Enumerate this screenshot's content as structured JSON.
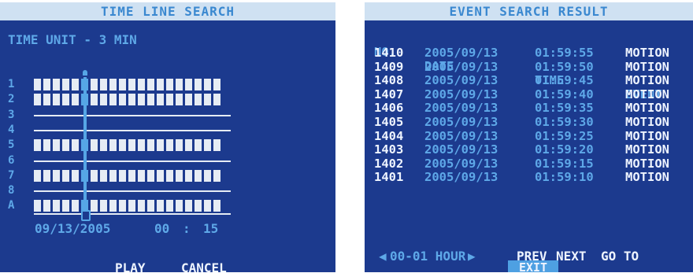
{
  "left_panel": {
    "title": "TIME LINE SEARCH",
    "time_unit": "TIME UNIT - 3 MIN",
    "channels": [
      {
        "label": "1",
        "has_recording": true
      },
      {
        "label": "2",
        "has_recording": true
      },
      {
        "label": "3",
        "has_recording": false
      },
      {
        "label": "4",
        "has_recording": false
      },
      {
        "label": "5",
        "has_recording": true
      },
      {
        "label": "6",
        "has_recording": false
      },
      {
        "label": "7",
        "has_recording": true
      },
      {
        "label": "8",
        "has_recording": false
      },
      {
        "label": "A",
        "has_recording": true
      }
    ],
    "date": "09/13/2005",
    "time_hour": "00",
    "time_sep": ":",
    "time_minute": "15",
    "play_label": "PLAY",
    "cancel_label": "CANCEL"
  },
  "right_panel": {
    "title": "EVENT SEARCH RESULT",
    "headers": {
      "no": "NO.",
      "date": "DATE",
      "time": "TIME",
      "event": "EVENT"
    },
    "rows": [
      {
        "no": "1410",
        "date": "2005/09/13",
        "time": "01:59:55",
        "event": "MOTION"
      },
      {
        "no": "1409",
        "date": "2005/09/13",
        "time": "01:59:50",
        "event": "MOTION"
      },
      {
        "no": "1408",
        "date": "2005/09/13",
        "time": "01:59:45",
        "event": "MOTION"
      },
      {
        "no": "1407",
        "date": "2005/09/13",
        "time": "01:59:40",
        "event": "MOTION"
      },
      {
        "no": "1406",
        "date": "2005/09/13",
        "time": "01:59:35",
        "event": "MOTION"
      },
      {
        "no": "1405",
        "date": "2005/09/13",
        "time": "01:59:30",
        "event": "MOTION"
      },
      {
        "no": "1404",
        "date": "2005/09/13",
        "time": "01:59:25",
        "event": "MOTION"
      },
      {
        "no": "1403",
        "date": "2005/09/13",
        "time": "01:59:20",
        "event": "MOTION"
      },
      {
        "no": "1402",
        "date": "2005/09/13",
        "time": "01:59:15",
        "event": "MOTION"
      },
      {
        "no": "1401",
        "date": "2005/09/13",
        "time": "01:59:10",
        "event": "MOTION"
      }
    ],
    "hour_range": "00-01 HOUR",
    "prev_label": "PREV",
    "next_label": "NEXT",
    "goto_label": "GO TO",
    "exit_label": "EXIT"
  },
  "colors": {
    "background": "#1c3a8e",
    "titlebar": "#cfe1f2",
    "accent": "#5ea8e8",
    "text_white": "#eef4ff"
  }
}
